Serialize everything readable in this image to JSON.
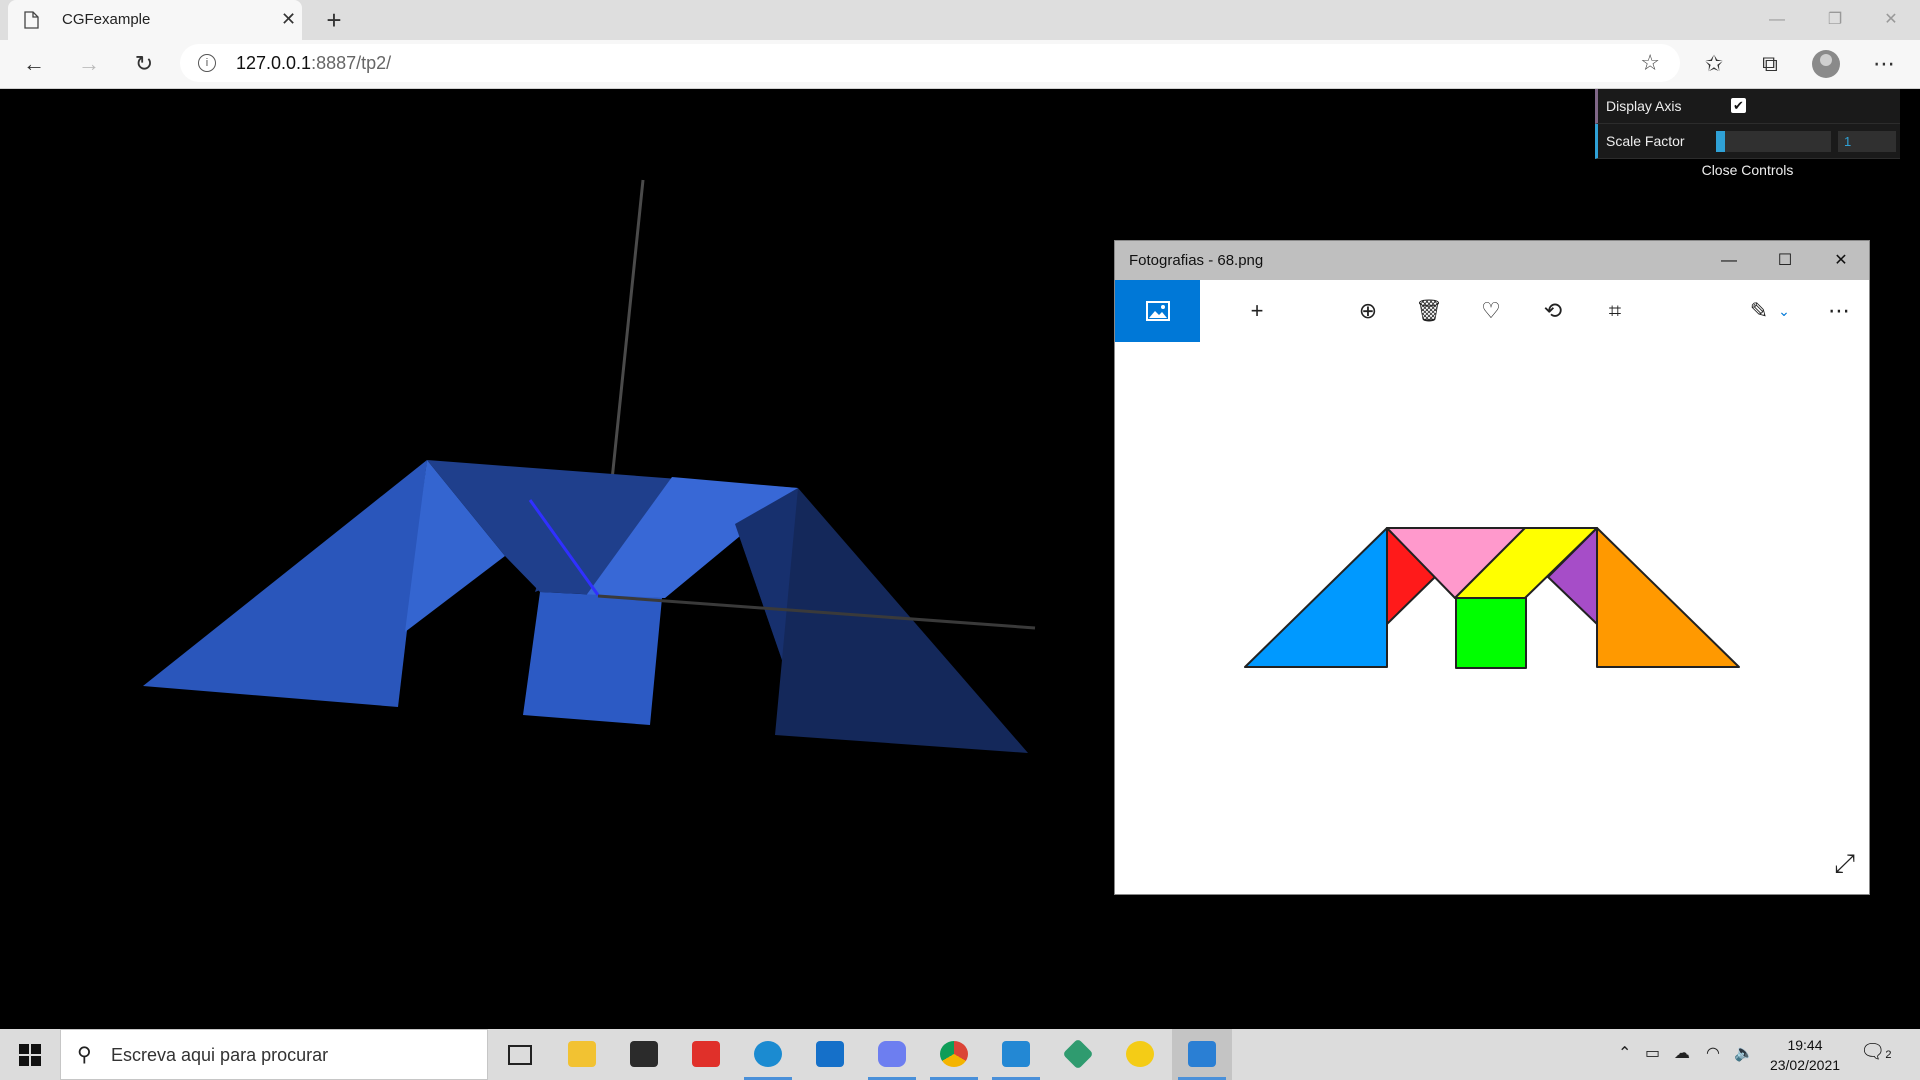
{
  "browser": {
    "tab_title": "CGFexample",
    "url_host": "127.0.0.1",
    "url_rest": ":8887/tp2/"
  },
  "gui": {
    "rows": [
      {
        "label": "Display Axis",
        "checked": true
      },
      {
        "label": "Scale Factor",
        "value": "1",
        "slider_fraction": 0.08
      }
    ],
    "close_label": "Close Controls"
  },
  "photos": {
    "title": "Fotografias - 68.png"
  },
  "taskbar": {
    "search_placeholder": "Escreva aqui para procurar",
    "time": "19:44",
    "date": "23/02/2021",
    "notifications": "2"
  },
  "colors": {
    "tangram_blue": "#0099ff",
    "tangram_red": "#ff1a1a",
    "tangram_pink": "#ff99cc",
    "tangram_yellow": "#ffff00",
    "tangram_purple": "#a64dc8",
    "tangram_green": "#00ff00",
    "tangram_orange": "#ff9900",
    "scene_blue": "#2f5fc8",
    "photos_accent": "#0078d7"
  }
}
